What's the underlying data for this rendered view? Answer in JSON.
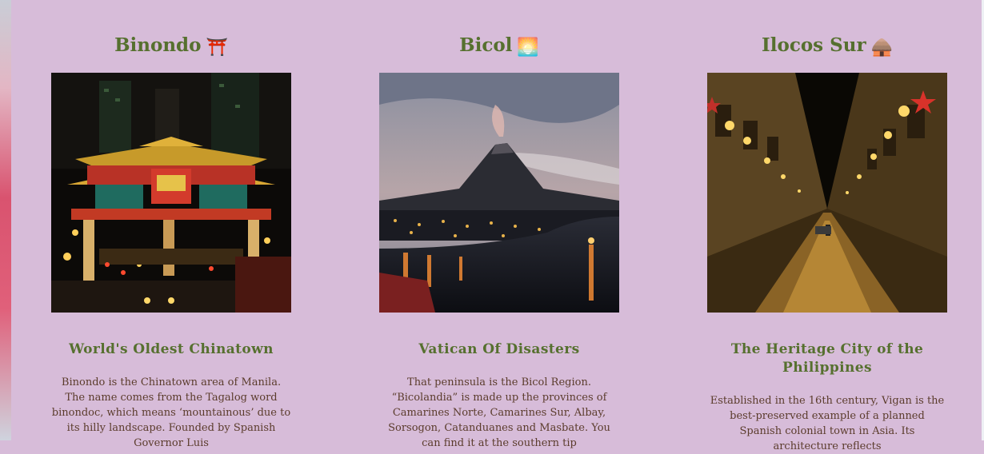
{
  "cards": [
    {
      "title": "Binondo",
      "emoji": "⛩️",
      "subtitle": "World's Oldest Chinatown",
      "text": "Binondo is the Chinatown area of Manila. The name comes from the Tagalog word binondoc, which means ‘mountainous’ due to its hilly landscape. Founded by Spanish Governor Luis"
    },
    {
      "title": "Bicol",
      "emoji": "🌅",
      "subtitle": "Vatican Of Disasters",
      "text": "That peninsula is the Bicol Region. “Bicolandia” is made up the provinces of Camarines Norte, Camarines Sur, Albay, Sorsogon, Catanduanes and Masbate. You can find it at the southern tip"
    },
    {
      "title": "Ilocos Sur",
      "emoji": "🛖",
      "subtitle": "The Heritage City of the Philippines",
      "text": "Established in the 16th century, Vigan is the best-preserved example of a planned Spanish colonial town in Asia. Its architecture reflects"
    }
  ],
  "colors": {
    "background": "#d7bcd9",
    "heading": "#56702f",
    "body_text": "#5b3c2c"
  },
  "icons": [
    "torii-gate-emoji",
    "sunrise-emoji",
    "hut-emoji"
  ]
}
